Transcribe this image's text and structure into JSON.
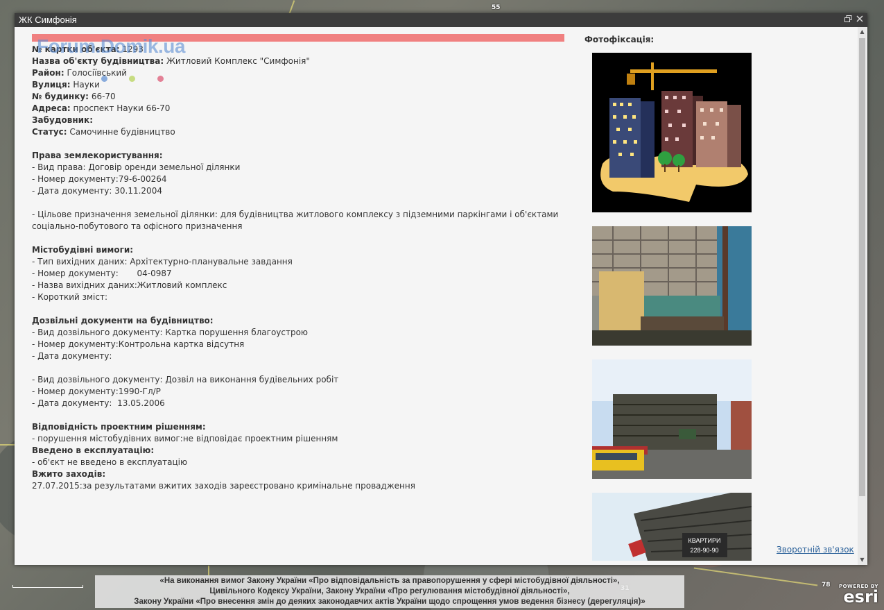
{
  "window": {
    "title": "ЖК Симфонія"
  },
  "watermark": "Forum.Domik.ua",
  "details": {
    "card_no_label": "№ картки об'єкта:",
    "card_no_value": "1293",
    "name_label": "Назва об'єкту будівництва:",
    "name_value": "Житловий Комплекс \"Симфонія\"",
    "district_label": "Район:",
    "district_value": "Голосіївський",
    "street_label": "Вулиця:",
    "street_value": "Науки",
    "building_label": "№ будинку:",
    "building_value": "66-70",
    "address_label": "Адреса:",
    "address_value": "проспект Науки 66-70",
    "developer_label": "Забудовник:",
    "status_label": "Статус:",
    "status_value": "Самочинне будівництво",
    "land_heading": "Права землекористування:",
    "land_lines": [
      "- Вид права: Договір оренди земельної ділянки",
      "- Номер документу:79-6-00264",
      "- Дата документу:  30.11.2004"
    ],
    "purpose_line1": "- Цільове призначення земельної ділянки: для будівництва житлового комплексу з підземними паркінгами і об'єктами",
    "purpose_line2": "соціально-побутового та офісного призначення",
    "urban_heading": "Містобудівні вимоги:",
    "urban_lines": [
      "- Тип вихідних даних: Архітектурно-планувальне завдання",
      "- Номер документу:       04-0987",
      "- Назва вихідних даних:Житловий комплекс",
      "- Короткий зміст:"
    ],
    "permits_heading": "Дозвільні документи на будівництво:",
    "permit1_lines": [
      "- Вид дозвільного документу: Картка порушення благоустрою",
      "- Номер документу:Контрольна картка відсутня",
      "- Дата документу:"
    ],
    "permit2_lines": [
      "- Вид дозвільного документу: Дозвіл на виконання будівельних робіт",
      "- Номер документу:1990-Гл/Р",
      "- Дата документу:  13.05.2006"
    ],
    "compliance_heading": "Відповідність проектним рішенням:",
    "compliance_value": "- порушення містобудівних вимог:не відповідає проектним рішенням",
    "commissioned_heading": "Введено в експлуатацію:",
    "commissioned_value": "- об'єкт не введено в експлуатацію",
    "measures_heading": "Вжито заходів:",
    "measures_value": "27.07.2015:за результатами вжитих заходів зареєстровано кримінальне провадження"
  },
  "photos": {
    "title": "Фотофіксація:",
    "banner_text_1": "КВАРТИРИ",
    "banner_text_2": "228-90-90"
  },
  "feedback_link": "Зворотній зв'язок",
  "legal": {
    "line1": "«На виконання вимог Закону України «Про відповідальність за правопорушення у сфері містобудівної діяльності»,",
    "line2": "Цивільного Кодексу України, Закону України «Про регулювання містобудівної діяльності»,",
    "line3": "Закону України «Про внесення змін до деяких законодавчих актів України щодо спрощення умов ведення бізнесу (дерегуляція)»"
  },
  "map": {
    "label_top": "55",
    "label_bottom_1": "78",
    "label_bottom_2": "31"
  },
  "esri": {
    "powered": "POWERED BY",
    "logo": "esri"
  },
  "colors": {
    "titlebar": "#3c3c3c",
    "redbar": "#f08080",
    "link": "#2a6099"
  }
}
